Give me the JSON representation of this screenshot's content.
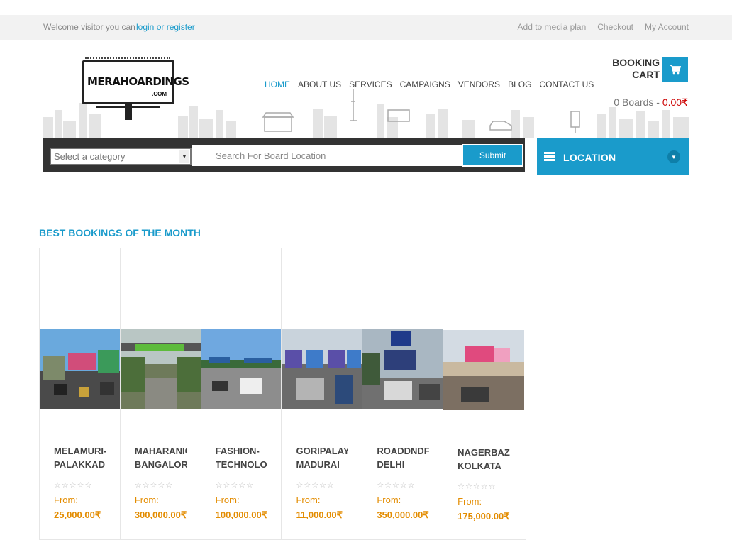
{
  "topbar": {
    "welcome": "Welcome visitor you can",
    "login": "login or register",
    "links": [
      "Add to media plan",
      "Checkout",
      "My Account"
    ]
  },
  "logo": {
    "main": "MERAHOARDINGS",
    "sub": ".COM"
  },
  "nav": [
    "HOME",
    "ABOUT US",
    "SERVICES",
    "CAMPAIGNS",
    "VENDORS",
    "BLOG",
    "CONTACT US"
  ],
  "cart": {
    "line1": "BOOKING",
    "line2": "CART",
    "boards": "0 Boards - ",
    "amount": "0.00₹",
    "icon": "shopping-cart-icon"
  },
  "search": {
    "category": "Select a category",
    "placeholder": "Search For Board Location",
    "submit": "Submit"
  },
  "location": {
    "label": "LOCATION",
    "icon": "menu-icon"
  },
  "section_title": "BEST BOOKINGS OF THE MONTH",
  "cards": [
    {
      "line1": "MELAMURI-",
      "line2": "PALAKKAD",
      "from": "From:",
      "price": "25,000.00₹"
    },
    {
      "line1": "MAHARANIC",
      "line2": "BANGALORE",
      "from": "From:",
      "price": "300,000.00₹"
    },
    {
      "line1": "FASHION-",
      "line2": "TECHNOLO",
      "from": "From:",
      "price": "100,000.00₹"
    },
    {
      "line1": "GORIPALAY",
      "line2": "MADURAI",
      "from": "From:",
      "price": "11,000.00₹"
    },
    {
      "line1": "ROADDNDF",
      "line2": "DELHI",
      "from": "From:",
      "price": "350,000.00₹"
    },
    {
      "line1": "NAGERBAZA",
      "line2": "KOLKATA",
      "from": "From:",
      "price": "175,000.00₹"
    }
  ],
  "colors": {
    "accent": "#1a9bcb",
    "price": "#e38c00",
    "dark": "#333333"
  }
}
